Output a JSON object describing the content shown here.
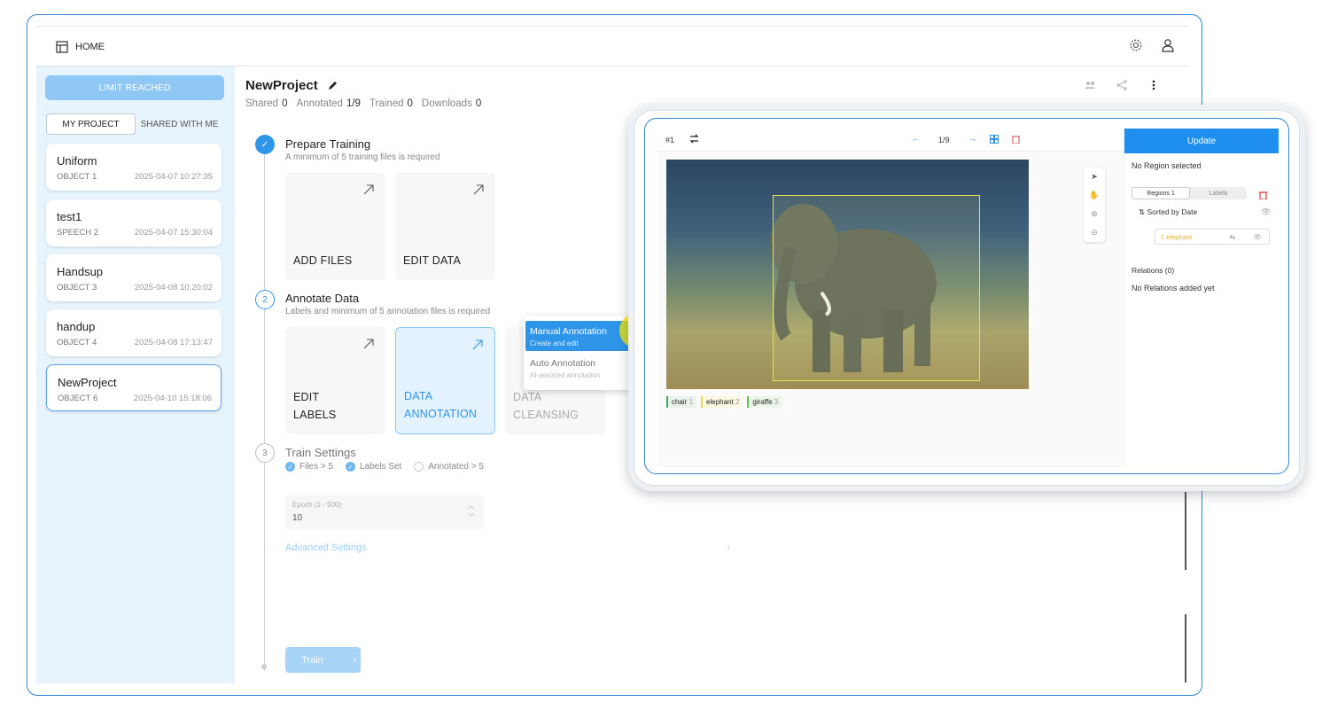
{
  "topbar": {
    "home_label": "HOME"
  },
  "sidebar": {
    "limit_label": "LIMIT REACHED",
    "tabs": [
      "MY PROJECT",
      "SHARED WITH ME"
    ],
    "projects": [
      {
        "name": "Uniform",
        "type": "OBJECT 1",
        "date": "2025-04-07 10:27:35"
      },
      {
        "name": "test1",
        "type": "SPEECH 2",
        "date": "2025-04-07 15:30:04"
      },
      {
        "name": "Handsup",
        "type": "OBJECT 3",
        "date": "2025-04-08 10:20:02"
      },
      {
        "name": "handup",
        "type": "OBJECT 4",
        "date": "2025-04-08 17:13:47"
      },
      {
        "name": "NewProject",
        "type": "OBJECT 6",
        "date": "2025-04-10 15:18:06"
      }
    ]
  },
  "project": {
    "title": "NewProject",
    "stats": [
      {
        "label": "Shared",
        "value": "0"
      },
      {
        "label": "Annotated",
        "value": "1/9"
      },
      {
        "label": "Trained",
        "value": "0"
      },
      {
        "label": "Downloads",
        "value": "0"
      }
    ]
  },
  "steps": {
    "step1": {
      "title": "Prepare Training",
      "sub": "A minimum of 5 training files is required",
      "cards": [
        "ADD FILES",
        "EDIT DATA"
      ]
    },
    "step2": {
      "num": "2",
      "title": "Annotate Data",
      "sub": "Labels and minimum of 5 annotation files is required",
      "cards": [
        "EDIT\nLABELS",
        "DATA\nANNOTATION",
        "DATA\nCLEANSING"
      ]
    },
    "step3": {
      "num": "3",
      "title": "Train Settings",
      "checks": [
        "Files > 5",
        "Labels Set",
        "Annotated > 5"
      ],
      "epoch_label": "Epoch (1 - 500)",
      "epoch_value": "10",
      "advanced_label": "Advanced Settings",
      "train_label": "Train"
    }
  },
  "dropdown": {
    "opt1_title": "Manual Annotation",
    "opt1_sub": "Create and edit",
    "opt2_title": "Auto Annotation",
    "opt2_sub": "AI-assisted annotation"
  },
  "tablet": {
    "image_index": "#1",
    "pager": "1/9",
    "update_label": "Update",
    "no_region": "No Region selected",
    "tabs": [
      "Regions 1",
      "Labels"
    ],
    "sorted": "Sorted by Date",
    "region_item": "1  elephant",
    "relations_title": "Relations (0)",
    "no_relations": "No Relations added yet",
    "tags": [
      {
        "label": "chair",
        "key": "1",
        "color": "#3aa56b"
      },
      {
        "label": "elephant",
        "key": "2",
        "color": "#e6d84a"
      },
      {
        "label": "giraffe",
        "key": "3",
        "color": "#5ac34a"
      }
    ]
  },
  "colors": {
    "accent": "#2e95e8",
    "frame": "#2f86d6"
  }
}
